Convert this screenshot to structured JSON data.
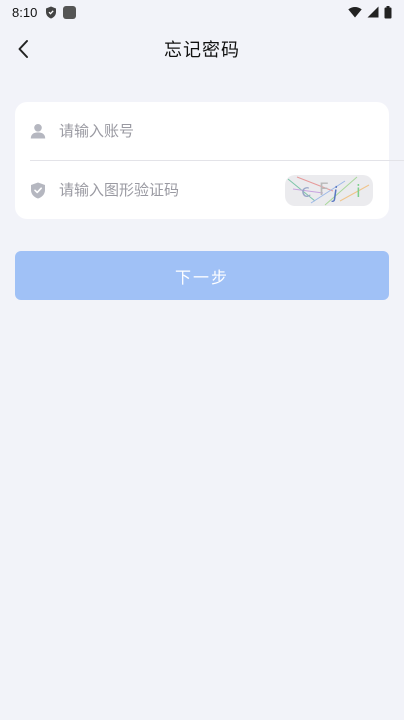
{
  "status_bar": {
    "time": "8:10"
  },
  "header": {
    "title": "忘记密码",
    "back_icon": "chevron-left-icon"
  },
  "form": {
    "account": {
      "icon": "user-icon",
      "placeholder": "请输入账号",
      "value": ""
    },
    "captcha": {
      "icon": "shield-check-icon",
      "placeholder": "请输入图形验证码",
      "value": "",
      "image_text": "c Fj i"
    }
  },
  "actions": {
    "next_label": "下一步"
  },
  "colors": {
    "background": "#f2f3f9",
    "primary_button": "#a0c1f6",
    "icon_gray": "#b5b7c0"
  }
}
